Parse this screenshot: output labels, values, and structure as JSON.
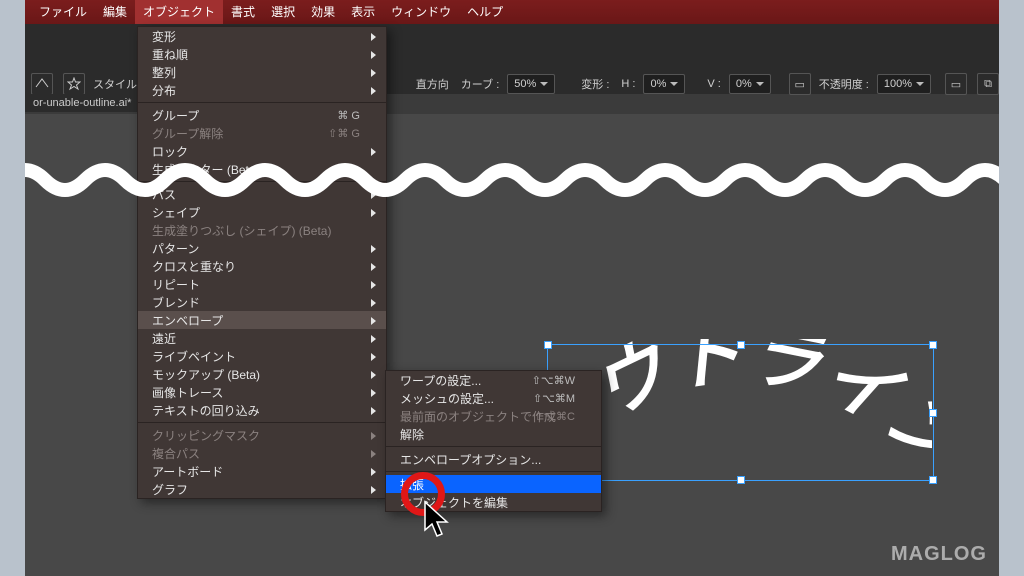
{
  "menubar": {
    "items": [
      "ファイル",
      "編集",
      "オブジェクト",
      "書式",
      "選択",
      "効果",
      "表示",
      "ウィンドウ",
      "ヘルプ"
    ],
    "active_index": 2
  },
  "optionsbar": {
    "label_style": "スタイル",
    "label_direction": "直方向",
    "label_curve": "カーブ :",
    "curve_value": "50%",
    "label_deform": "変形 :",
    "h_label": "H :",
    "h_value": "0%",
    "v_label": "V :",
    "v_value": "0%",
    "opacity_label": "不透明度 :",
    "opacity_value": "100%"
  },
  "doc_tab": "or-unable-outline.ai*",
  "dropdown_object": {
    "sections": [
      [
        {
          "label": "変形",
          "sub": true
        },
        {
          "label": "重ね順",
          "sub": true
        },
        {
          "label": "整列",
          "sub": true
        },
        {
          "label": "分布",
          "sub": true
        }
      ],
      [
        {
          "label": "グループ",
          "shortcut": "⌘ G"
        },
        {
          "label": "グループ解除",
          "shortcut": "⇧⌘ G",
          "disabled": true
        },
        {
          "label": "ロック",
          "sub": true
        },
        {
          "label": "生成ベクター (Beta)..."
        }
      ],
      [
        {
          "label": "パス",
          "sub": true
        },
        {
          "label": "シェイプ",
          "sub": true
        },
        {
          "label": "生成塗りつぶし (シェイプ) (Beta)",
          "disabled": true
        },
        {
          "label": "パターン",
          "sub": true
        },
        {
          "label": "クロスと重なり",
          "sub": true
        },
        {
          "label": "リピート",
          "sub": true
        },
        {
          "label": "ブレンド",
          "sub": true
        },
        {
          "label": "エンベロープ",
          "sub": true,
          "hover": true
        },
        {
          "label": "遠近",
          "sub": true
        },
        {
          "label": "ライブペイント",
          "sub": true
        },
        {
          "label": "モックアップ (Beta)",
          "sub": true
        },
        {
          "label": "画像トレース",
          "sub": true
        },
        {
          "label": "テキストの回り込み",
          "sub": true
        }
      ],
      [
        {
          "label": "クリッピングマスク",
          "sub": true,
          "disabled": true
        },
        {
          "label": "複合パス",
          "sub": true,
          "disabled": true
        },
        {
          "label": "アートボード",
          "sub": true
        },
        {
          "label": "グラフ",
          "sub": true
        }
      ]
    ]
  },
  "submenu_envelope": {
    "sections": [
      [
        {
          "label": "ワープの設定...",
          "shortcut": "⇧⌥⌘W"
        },
        {
          "label": "メッシュの設定...",
          "shortcut": "⇧⌥⌘M"
        },
        {
          "label": "最前面のオブジェクトで作成",
          "shortcut": "⇧⌥⌘C",
          "disabled": true
        },
        {
          "label": "解除"
        }
      ],
      [
        {
          "label": "エンベロープオプション..."
        }
      ],
      [
        {
          "label": "拡張",
          "highlight": true
        },
        {
          "label": "オブジェクトを編集"
        }
      ]
    ]
  },
  "canvas_text": "アウトライン化",
  "watermark": "MAGLOG"
}
